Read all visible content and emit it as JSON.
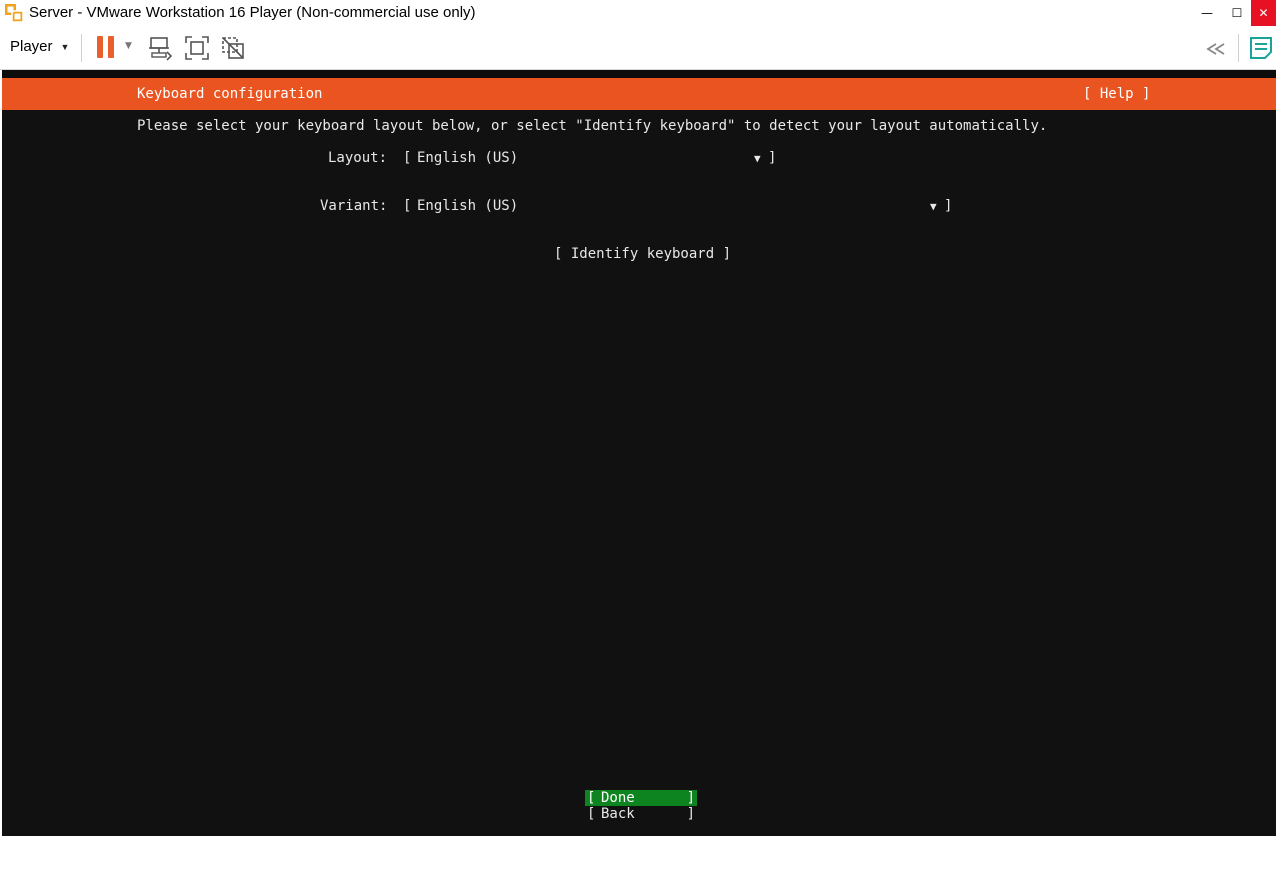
{
  "window": {
    "title": "Server - VMware Workstation 16 Player (Non-commercial use only)",
    "minimize_glyph": "—",
    "maximize_glyph": "☐",
    "close_glyph": "✕"
  },
  "toolbar": {
    "player_menu_label": "Player",
    "icons": [
      "pause-icon",
      "send-ctrl-alt-del-icon",
      "fullscreen-icon",
      "unity-icon",
      "collapse-icon",
      "notes-icon"
    ],
    "accent_color": "#e8602c"
  },
  "installer": {
    "header_title": "Keyboard configuration",
    "help_label": "[ Help ]",
    "intro_text": "Please select your keyboard layout below, or select \"Identify keyboard\" to detect your layout automatically.",
    "layout": {
      "label": "Layout:",
      "value": "English (US)"
    },
    "variant": {
      "label": "Variant:",
      "value": "English (US)"
    },
    "identify_button": "[ Identify keyboard ]",
    "done_button": "Done",
    "back_button": "Back",
    "header_color": "#e95420",
    "done_color": "#0e8420"
  }
}
